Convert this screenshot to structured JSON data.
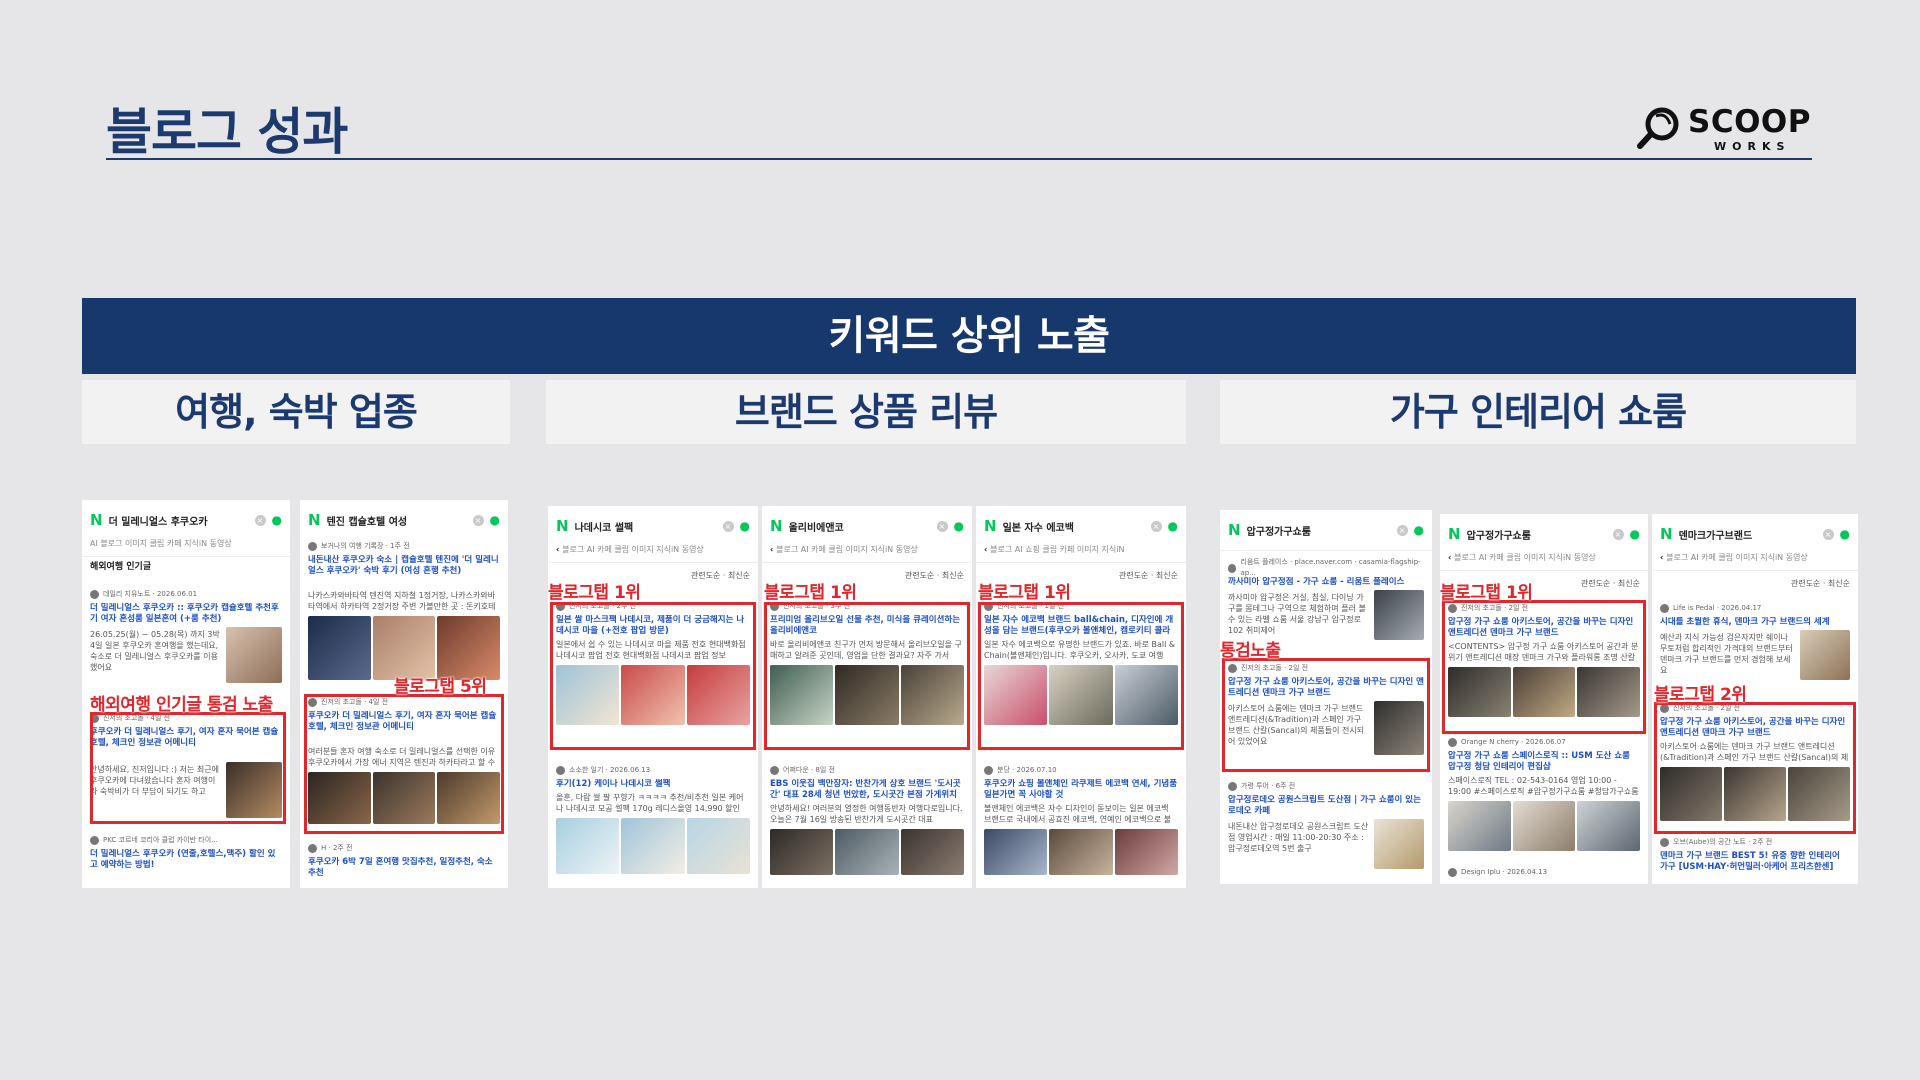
{
  "title": "블로그 성과",
  "logo": {
    "main": "SCOOP",
    "sub": "WORKS"
  },
  "banner": "키워드 상위 노출",
  "categories": [
    "여행, 숙박 업종",
    "브랜드 상품 리뷰",
    "가구 인테리어 쇼룸"
  ],
  "highlights": {
    "s1": "해외여행 인기글 통검 노출",
    "s2": "블로그탭 5위",
    "s3": "블로그탭 1위",
    "s4": "블로그탭 1위",
    "s5": "블로그탭 1위",
    "s6": "통검노출",
    "s7": "블로그탭 1위",
    "s8": "블로그탭 2위"
  },
  "tabs_common": "블로그",
  "screens": {
    "s1": {
      "query": "더 밀레니얼스 후쿠오카",
      "tabs": "AI 블로그 이미지 클립 카페 지식iN 동영상",
      "section": "해외여행 인기글",
      "e1_meta": "데일리 지유노트 · 2026.06.01",
      "e1_title": "더 밀레니얼스 후쿠오카 :: 후쿠오카 캡슐호텔 추천후기 여자 혼성룸 일본혼여 (+룸 추천)",
      "e1_desc": "26.05.25(월) ~ 05.28(목) 까지 3박4일 일본 후쿠오카 혼여행을 했는데요, 숙소로 더 밀레니얼스 후쿠오카를 이용했어요",
      "e2_meta": "진저의 초고돌 · 4일 전",
      "e2_title": "후쿠오카 더 밀레니얼스 후기, 여자 혼자 묵어본 캡슐호텔, 체크인 정보관 어메니티",
      "e2_desc": "안녕하세요, 진저입니다 :) 저는 최근에 후쿠오카에 다녀왔습니다 혼자 여행이라 숙박비가 더 부담이 되기도 하고",
      "e3_meta": "PKC 코르네 코리아 클럽 카이반 타이...",
      "e3_title": "더 밀레니얼스 후쿠오카 (연줄,호텔스,맥주) 할인 있고 예약하는 방법!"
    },
    "s2": {
      "query": "텐진 캡슐호텔 여성",
      "e1_meta": "보거나의 여행 기록장 · 1주 전",
      "e1_title": "내돈내산 후쿠오카 숙소 | 캡슐호텔 텐진에 '더 밀레니얼스 후쿠오카' 숙박 후기 (여성 혼행 추천)",
      "e1_desc": "나카스카와바타역 텐진역 지하철 1정거장, 나카스카와바타역에서 하카타역 2정거장 주변 가볼만한 곳 : 돈키호테",
      "e2_meta": "진저의 초고돌 · 4일 전",
      "e2_title": "후쿠오카 더 밀레니얼스 후기, 여자 혼자 묵어본 캡슐호텔, 체크인 정보관 어메니티",
      "e2_desc": "여러분들 혼자 여행 숙소로 더 밀레니얼스를 선택한 이유 후쿠오카에서 가장 에너 지역은 텐진과 하카타라고 할 수",
      "e3_meta": "H · 2주 전",
      "e3_title": "후쿠오카 6박 7일 혼여행 맛집추천, 일정추천, 숙소 추천"
    },
    "s3": {
      "query": "나데시코 썰팩",
      "tabs": "블로그 AI 카페 클립 이미지 지식iN 동영상",
      "filter": "관련도순 · 최신순",
      "e1_meta": "진저의 초고돌 · 2주 전",
      "e1_title": "일본 쌀 마스크팩 나데시코, 제품이 더 궁금해지는 나데시코 마을 (+전호 팝업 방문)",
      "e1_desc": "일본에서 쉽 수 있는 나데시코 마을 제품 전호 현대백화점 나데시코 팝업 전호 현대백화점 나데시코 팝업 정보",
      "e2_meta": "소소한 일기 · 2026.06.13",
      "e2_title": "후기(12) 케이나 나데시코 썰팩",
      "e2_desc": "올훈, 다람 쌀 팔 꾸향가 ㅋㅋㅋㅋ 추천/비추천 일본 케어나 나데시코 모공 썰팩 170g 레디스올영 14,990 할인"
    },
    "s4": {
      "query": "올리비에앤코",
      "tabs": "블로그 AI 카페 클립 이미지 지식iN 동영상",
      "filter": "관련도순 · 최신순",
      "e1_meta": "진저의 초고돌 · 3주 전",
      "e1_title": "프리미엄 올리브오일 선물 추천, 미식을 큐레이션하는 올리비에앤코",
      "e1_desc": "바로 올리비에앤코 친구가 먼저 방문해서 올리브오일을 구매하고 알려준 곳인데, 영업을 단한 결과요? 자주 가서",
      "e2_meta": "어쩌다운 · 8일 전",
      "e2_title": "EBS 이웃집 백만장자: 반찬가게 상호 브랜드 '도시곳간' 대표 28세 청년 번았한, 도시곳간 본점 가게위치",
      "e2_desc": "안녕하세요! 여러분의 열정한 여행동반자 여행다로입니다. 오늘은 7월 16일 방송된 반찬가게 도시곳간 대표"
    },
    "s5": {
      "query": "일본 자수 에코백",
      "tabs": "블로그 AI 쇼핑 클립 카페 이미지 지식iN",
      "filter": "관련도순 · 최신순",
      "e1_meta": "진저의 초고돌 · 1일 전",
      "e1_title": "일본 자수 에코백 브랜드 ball&chain, 디자인에 개성을 담는 브랜드(후쿠오카 볼앤체인, 캠로키티 콜라",
      "e1_desc": "일본 자수 에코백으로 유명한 브랜드가 있죠. 바로 Ball & Chain(볼앤체인)입니다. 후쿠오카, 오사카, 도쿄 여행",
      "e2_meta": "분당 · 2026.07.10",
      "e2_title": "후쿠오카 쇼핑 볼앤체인 라쿠제트 에코백 연세, 기념품 일본가면 꼭 사야할 것",
      "e2_desc": "볼앤체인 에코백은 자수 디자인이 돋보이는 일본 에코백 브랜드로 국내에서 공효진 에코백, 연예인 에코백으로 불리"
    },
    "s6": {
      "query": "압구정가구쇼룸",
      "tabs": "",
      "e1_meta": "리움트 플레이스 · place.naver.com · casamia-flagship-ap...",
      "e1_title": "까사미아 압구정점 - 가구 쇼룸 - 리움트 플레이스",
      "e1_desc": "까사미아 압구정은 거실, 침실, 다이닝 가구를 몸테그나 구역으로 체험하며 플러 볼 수 있는 라벨 쇼룸 서울 강남구 압구정로 102 취미제어",
      "e2_meta": "진저의 초고돌 · 2일 전",
      "e2_title": "압구정 가구 쇼룸 아키스토어, 공간을 바꾸는 디자인 앤트레디션 덴마크 가구 브랜드",
      "e2_desc": "아키스토어 쇼룸에는 덴마크 가구 브랜드 앤트레디션(&Tradition)과 스페인 가구 브랜드 산칼(Sancal)의 제품들이 전시되어 있었어요",
      "e3_meta": "가령 투어 · 6주 전",
      "e3_title": "압구정로데오 공원스크립트 도산점 | 가구 쇼룸이 있는 로데오 카페",
      "e3_desc": "내돈내산 압구정로데오 공원스크립트 도산점 영업시간 : 매일 11:00-20:30 주소 : 압구정로데오역 5번 출구"
    },
    "s7": {
      "query": "압구정가구쇼룸",
      "tabs": "블로그 AI 카페 클립 이미지 지식iN 동영상",
      "filter": "관련도순 · 최신순",
      "e1_meta": "진저의 초고돌 · 2일 전",
      "e1_title": "압구정 가구 쇼룸 아키스토어, 공간을 바꾸는 디자인 앤트레디션 덴마크 가구 브랜드",
      "e1_desc": "<CONTENTS> 압구정 가구 쇼룸 아키스토어 공간과 분위기 앤트레디션 매장 덴마크 가구와 플라워롱 조명 산칼",
      "e2_meta": "Orange N cherry · 2026.06.07",
      "e2_title": "압구정 가구 쇼룸 스페이스로직 :: USM 도산 쇼룸 압구정 청담 인테리어 편집샵",
      "e2_desc": "스페이스로직 TEL : 02-543-0164 영업 10:00 - 19:00 #스페이스로직 #압구정가구쇼룸 #청담가구쇼룸 #USM쇼룸",
      "e3_meta": "Design Iplu · 2026.04.13"
    },
    "s8": {
      "query": "덴마크가구브랜드",
      "tabs": "블로그 AI 카페 클립 이미지 지식iN 동영상",
      "filter": "관련도순 · 최신순",
      "e1_meta": "Life is Pedal · 2026.04.17",
      "e1_title": "시대를 초월한 휴식, 덴마크 가구 브랜드의 세계",
      "e1_desc": "예산과 지식 가능성 검은자지만 쉐이나 무토처럼 합리적인 가격대의 브랜드부터 덴마크 가구 브랜드를 먼저 경험해 보세요",
      "e2_meta": "진저의 초고돌 · 2일 전",
      "e2_title": "압구정 가구 쇼룸 아키스토어, 공간을 바꾸는 디자인 앤트레디션 덴마크 가구 브랜드",
      "e2_desc": "아키스토어 쇼룸에는 덴마크 가구 브랜드 앤트레디션(&Tradition)과 스페인 가구 브랜드 산칼(Sancal)의 제품들이",
      "e3_meta": "오브(Aube)의 공간 노트 · 2주 전",
      "e3_title": "덴마크 가구 브랜드 BEST 5! 유중 향한 인테리어 가구 [USM·HAY·허먼밀러·아케어 프리츠한센]"
    }
  },
  "colors": {
    "navy": "#17386c",
    "title": "#1c3a6e",
    "highlight": "#e3262b",
    "naver_green": "#03c75a",
    "link_blue": "#1c4fc8"
  }
}
